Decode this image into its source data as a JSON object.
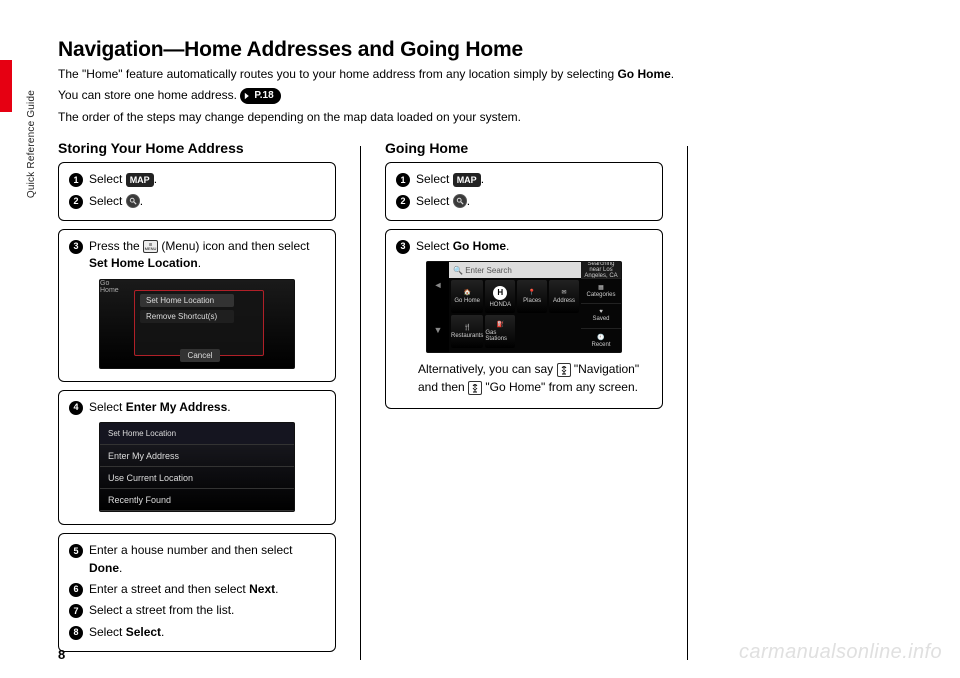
{
  "sidebar": {
    "label": "Quick Reference Guide"
  },
  "title": "Navigation—Home Addresses and Going Home",
  "intro": {
    "line1_a": "The \"Home\" feature automatically routes you to your home address from any location simply by selecting ",
    "line1_b": "Go Home",
    "line1_c": ".",
    "line2_a": "You can store one home address. ",
    "pref": "P.18",
    "line3": "The order of the steps may change depending on the map data loaded on your system."
  },
  "storing": {
    "title": "Storing Your Home Address",
    "step1": "Select ",
    "step1_btn": "MAP",
    "step1_end": ".",
    "step2": "Select ",
    "step2_end": ".",
    "step3a": "Press the ",
    "step3b": " (Menu) icon and then select ",
    "step3c": "Set Home Location",
    "step3d": ".",
    "ss1": {
      "sethome": "Set Home Location",
      "remshort": "Remove Shortcut(s)",
      "cancel": "Cancel",
      "gohome": "Go Home"
    },
    "step4a": "Select ",
    "step4b": "Enter My Address",
    "step4c": ".",
    "ss2": {
      "hdr": "Set Home Location",
      "r1": "Enter My Address",
      "r2": "Use Current Location",
      "r3": "Recently Found"
    },
    "step5a": "Enter a house number and then select ",
    "step5b": "Done",
    "step5c": ".",
    "step6a": "Enter a street and then select ",
    "step6b": "Next",
    "step6c": ".",
    "step7": "Select a street from the list.",
    "step8a": "Select ",
    "step8b": "Select",
    "step8c": "."
  },
  "going": {
    "title": "Going Home",
    "step1": "Select ",
    "step1_btn": "MAP",
    "step1_end": ".",
    "step2": "Select ",
    "step2_end": ".",
    "step3a": "Select ",
    "step3b": "Go Home",
    "step3c": ".",
    "ss3": {
      "search": "Enter Search",
      "info": "Searching near Los Angeles, CA",
      "cells": [
        "Go Home",
        "HONDA",
        "Places",
        "Address",
        "Restaurants",
        "Gas Stations"
      ],
      "right": [
        "Categories",
        "Saved",
        "Recent"
      ]
    },
    "alt_a": "Alternatively, you can say ",
    "alt_b": "\"",
    "alt_c": "Navigation",
    "alt_d": "\" and then ",
    "alt_e": " \"",
    "alt_f": "Go Home",
    "alt_g": "\" from any screen."
  },
  "page": "8",
  "watermark": "carmanualsonline.info",
  "icons": {
    "magnify_q": "Q",
    "menu": "MENU"
  }
}
